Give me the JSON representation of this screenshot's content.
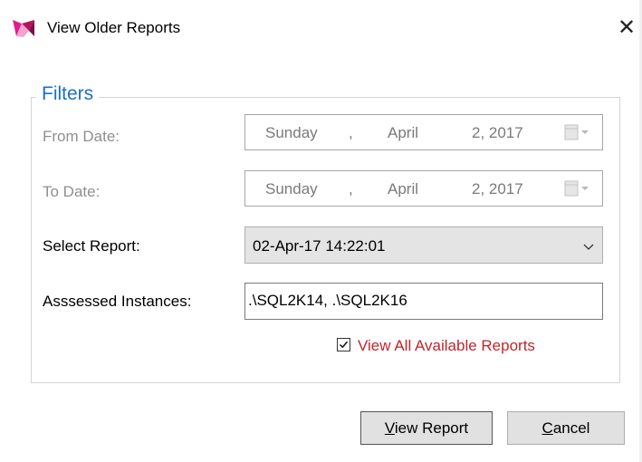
{
  "window": {
    "title": "View Older Reports",
    "icon": "app-logo-icon",
    "close_glyph": "✕"
  },
  "filters": {
    "legend": "Filters",
    "from_date": {
      "label": "From Date:",
      "weekday": "Sunday",
      "sep": ",",
      "month": "April",
      "day_year": "2, 2017"
    },
    "to_date": {
      "label": "To Date:",
      "weekday": "Sunday",
      "sep": ",",
      "month": "April",
      "day_year": "2, 2017"
    },
    "select_report": {
      "label": "Select Report:",
      "value": "02-Apr-17 14:22:01"
    },
    "instances": {
      "label": "Asssessed Instances:",
      "value": ".\\SQL2K14, .\\SQL2K16"
    },
    "view_all": {
      "label": "View All Available Reports",
      "checked": true
    }
  },
  "buttons": {
    "view_report": {
      "mnemonic": "V",
      "rest": "iew Report"
    },
    "cancel": {
      "mnemonic": "C",
      "rest": "ancel"
    }
  },
  "colors": {
    "legend": "#1c6fc6",
    "link_red": "#c0262c",
    "disabled_text": "#8f8f8f"
  }
}
